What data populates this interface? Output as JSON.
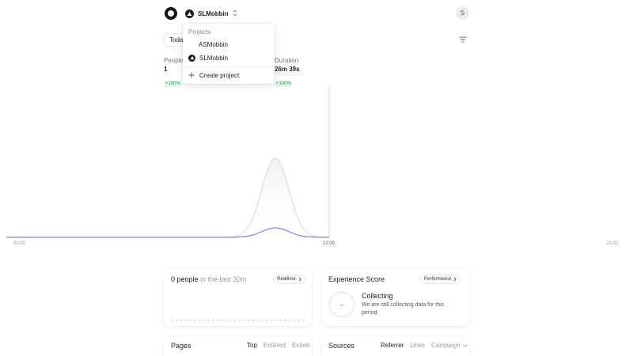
{
  "header": {
    "project_name": "SLMobbin",
    "user_initial": "S"
  },
  "date_picker": {
    "label": "Today"
  },
  "stats": [
    {
      "label": "People",
      "value": "1",
      "change": "+100%"
    },
    {
      "label": "Duration",
      "value": "26m 39s",
      "change": "+100%"
    }
  ],
  "project_menu": {
    "heading": "Projects",
    "items": [
      {
        "label": "ASMobbin",
        "has_icon": false
      },
      {
        "label": "SLMobbin",
        "has_icon": true
      }
    ],
    "create_label": "Create project"
  },
  "chart_data": {
    "type": "area",
    "x_ticks": [
      "00:00",
      "12:00",
      "23:00"
    ],
    "highlighted_tick": "12:00",
    "series": [
      {
        "color": "#dcdcdc",
        "peak_time": "10:00",
        "shape": "bell",
        "relative_peak": 1.0
      },
      {
        "color": "#8b7cf2",
        "peak_time": "10:00",
        "shape": "bell",
        "relative_peak": 0.12
      }
    ],
    "grid": false
  },
  "realtime_card": {
    "count_text": "0 people",
    "suffix_text": "in the last 30m",
    "button_label": "Realtime"
  },
  "experience_card": {
    "title": "Experience Score",
    "button_label": "Performance",
    "score_placeholder": "–",
    "status_title": "Collecting",
    "status_text": "We are still collecting data for this period."
  },
  "pages_card": {
    "title": "Pages",
    "tabs": [
      {
        "label": "Top",
        "active": true
      },
      {
        "label": "Entered",
        "active": false
      },
      {
        "label": "Exited",
        "active": false
      }
    ]
  },
  "sources_card": {
    "title": "Sources",
    "tabs": [
      {
        "label": "Referrer",
        "active": true
      },
      {
        "label": "Links",
        "active": false
      },
      {
        "label": "Campaign",
        "active": false
      }
    ]
  },
  "colors": {
    "accent": "#8b7cf2",
    "positive": "#2f9a53",
    "primary_line": "#dcdcdc"
  }
}
